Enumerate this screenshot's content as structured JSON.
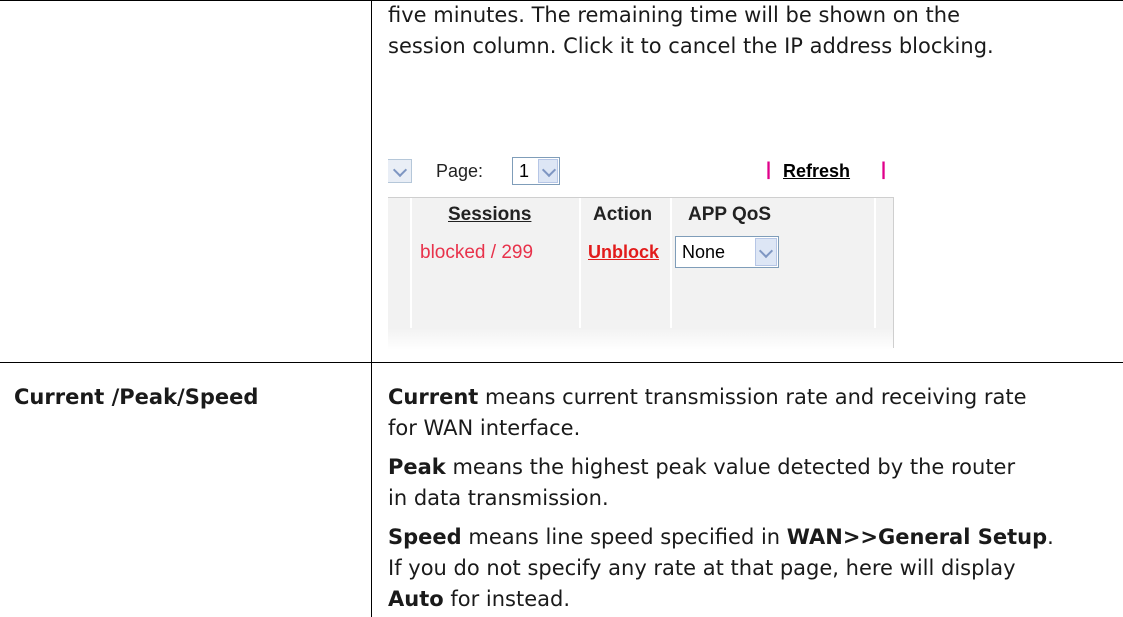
{
  "top_row": {
    "description_lines": [
      "five minutes. The remaining time will be shown on the",
      "session column. Click it to cancel the IP address blocking."
    ]
  },
  "screenshot": {
    "page_label": "Page:",
    "page_value": "1",
    "pipe": "|",
    "refresh_label": "Refresh",
    "headers": {
      "sessions": "Sessions",
      "action": "Action",
      "app_qos": "APP QoS"
    },
    "row": {
      "sessions": "blocked / 299",
      "action": "Unblock",
      "app_qos": "None"
    }
  },
  "bottom_row": {
    "item_label": "Current /Peak/Speed",
    "current": {
      "term": "Current",
      "line1": " means current transmission rate and receiving rate",
      "line2": "for WAN interface."
    },
    "peak": {
      "term": "Peak",
      "line1": " means the highest peak value detected by the router",
      "line2": "in data transmission."
    },
    "speed": {
      "term": "Speed",
      "line1_a": " means line speed specified in ",
      "line1_b": "WAN>>General Setup",
      "line1_c": ".",
      "line2": "If you do not specify any rate at that page, here will display",
      "line3_b": "Auto",
      "line3_c": " for instead."
    }
  }
}
